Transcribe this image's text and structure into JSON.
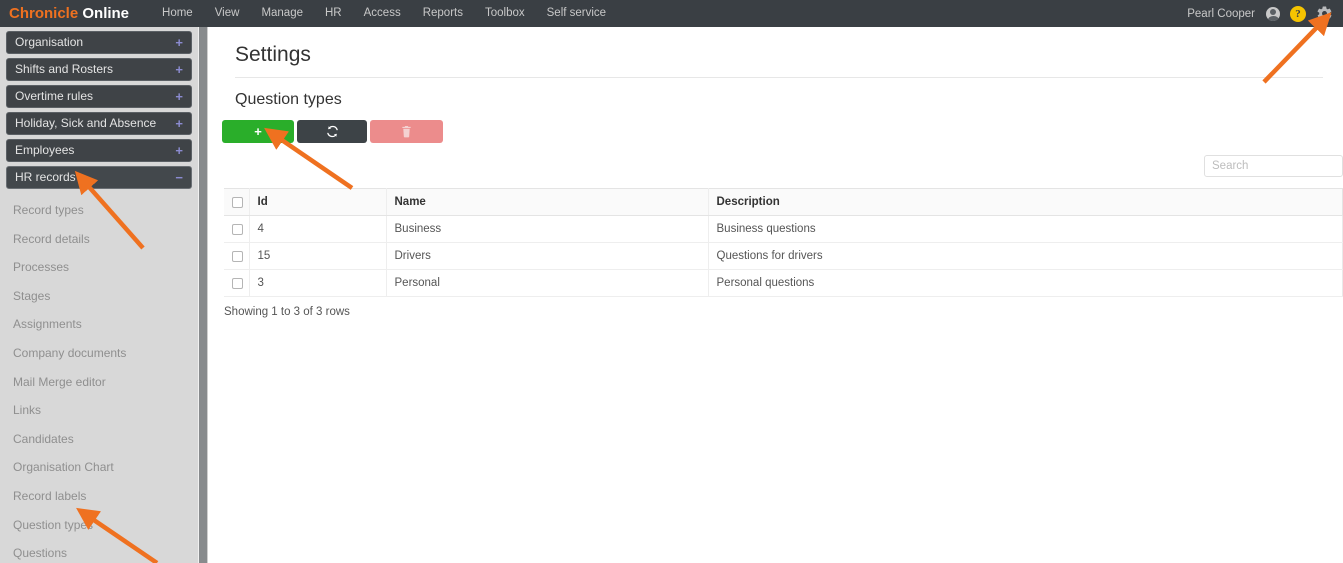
{
  "topnav": {
    "brand_first": "Chronicle",
    "brand_second": "Online",
    "brand_color": "#ef7120",
    "background": "#3a3f44",
    "links": [
      {
        "label": "Home"
      },
      {
        "label": "View"
      },
      {
        "label": "Manage"
      },
      {
        "label": "HR"
      },
      {
        "label": "Access"
      },
      {
        "label": "Reports"
      },
      {
        "label": "Toolbox"
      },
      {
        "label": "Self service"
      }
    ],
    "user_name": "Pearl Cooper",
    "avatar_icon": "user-avatar-icon",
    "help_icon": "help-question-icon",
    "help_glyph": "?",
    "help_color": "#f5c400",
    "settings_icon": "gear-icon"
  },
  "sidebar": {
    "groups": [
      {
        "label": "Organisation",
        "toggle": "+",
        "expanded": false
      },
      {
        "label": "Shifts and Rosters",
        "toggle": "+",
        "expanded": false
      },
      {
        "label": "Overtime rules",
        "toggle": "+",
        "expanded": false
      },
      {
        "label": "Holiday, Sick and Absence",
        "toggle": "+",
        "expanded": false
      },
      {
        "label": "Employees",
        "toggle": "+",
        "expanded": false
      },
      {
        "label": "HR records",
        "toggle": "−",
        "expanded": true
      }
    ],
    "sub_items": [
      {
        "label": "Record types"
      },
      {
        "label": "Record details"
      },
      {
        "label": "Processes"
      },
      {
        "label": "Stages"
      },
      {
        "label": "Assignments"
      },
      {
        "label": "Company documents"
      },
      {
        "label": "Mail Merge editor"
      },
      {
        "label": "Links"
      },
      {
        "label": "Candidates"
      },
      {
        "label": "Organisation Chart"
      },
      {
        "label": "Record labels"
      },
      {
        "label": "Question types"
      },
      {
        "label": "Questions"
      }
    ]
  },
  "main": {
    "page_title": "Settings",
    "section_title": "Question types",
    "toolbar": {
      "add_label": "+",
      "add_icon": "plus-icon",
      "add_color": "#2aae2a",
      "refresh_label": "",
      "refresh_icon": "refresh-icon",
      "refresh_color": "#3d4347",
      "delete_label": "",
      "delete_icon": "trash-icon",
      "delete_color": "#ec8c8c"
    },
    "search": {
      "placeholder": "Search",
      "value": ""
    },
    "table": {
      "columns": [
        "",
        "Id",
        "Name",
        "Description"
      ],
      "rows": [
        {
          "id": "4",
          "name": "Business",
          "description": "Business questions"
        },
        {
          "id": "15",
          "name": "Drivers",
          "description": "Questions for drivers"
        },
        {
          "id": "3",
          "name": "Personal",
          "description": "Personal questions"
        }
      ]
    },
    "row_count_text": "Showing 1 to 3 of 3 rows"
  },
  "annotations": {
    "arrow_color": "#ef7120",
    "arrows": [
      {
        "name": "arrow-to-settings-gear"
      },
      {
        "name": "arrow-to-hr-records"
      },
      {
        "name": "arrow-to-add-button"
      },
      {
        "name": "arrow-to-question-types"
      }
    ]
  }
}
